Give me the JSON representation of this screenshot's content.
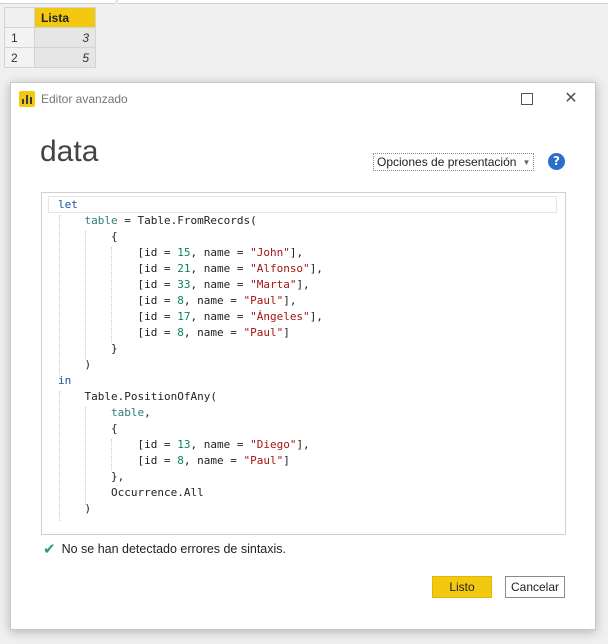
{
  "background_table": {
    "column_header": "Lista",
    "rows": [
      {
        "index": "1",
        "value": "3"
      },
      {
        "index": "2",
        "value": "5"
      }
    ]
  },
  "dialog": {
    "title": "Editor avanzado",
    "query_name": "data",
    "display_options_label": "Opciones de presentación",
    "help_icon_glyph": "?",
    "status_message": "No se han detectado errores de sintaxis.",
    "done_label": "Listo",
    "cancel_label": "Cancelar"
  },
  "code_lines": [
    "let",
    "    table = Table.FromRecords(",
    "        {",
    "            [id = 15, name = \"John\"],",
    "            [id = 21, name = \"Alfonso\"],",
    "            [id = 33, name = \"Marta\"],",
    "            [id = 8, name = \"Paul\"],",
    "            [id = 17, name = \"Ángeles\"],",
    "            [id = 8, name = \"Paul\"]",
    "        }",
    "    )",
    "in",
    "    Table.PositionOfAny(",
    "        table,",
    "        {",
    "            [id = 13, name = \"Diego\"],",
    "            [id = 8, name = \"Paul\"]",
    "        },",
    "        Occurrence.All",
    "    )"
  ],
  "colors": {
    "accent": "#f2c811",
    "keyword": "#1e4fa8",
    "variable": "#2f7d7d",
    "number": "#098658",
    "string": "#a31515",
    "success": "#2d9d6a"
  }
}
